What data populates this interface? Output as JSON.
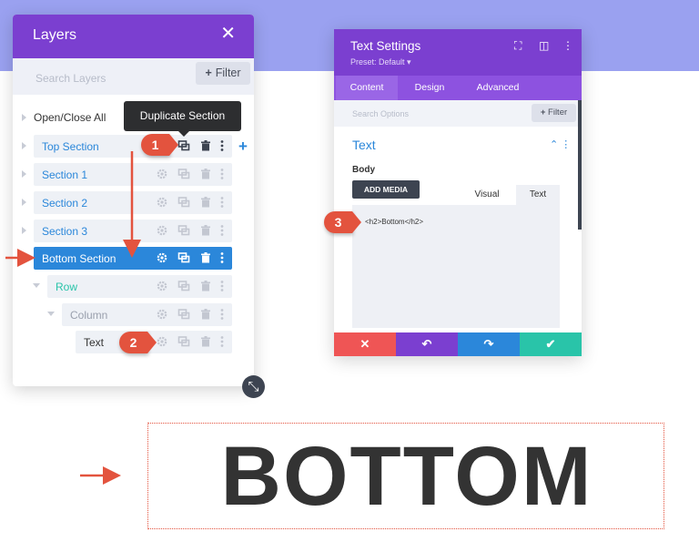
{
  "layers_panel": {
    "title": "Layers",
    "close_icon": "close-icon",
    "search_placeholder": "Search Layers",
    "filter_label": "Filter",
    "open_close_all": "Open/Close All",
    "tooltip": "Duplicate Section",
    "items": [
      {
        "label": "Top Section",
        "type": "section"
      },
      {
        "label": "Section 1",
        "type": "section"
      },
      {
        "label": "Section 2",
        "type": "section"
      },
      {
        "label": "Section 3",
        "type": "section"
      },
      {
        "label": "Bottom Section",
        "type": "section",
        "selected": true
      },
      {
        "label": "Row",
        "type": "row"
      },
      {
        "label": "Column",
        "type": "column"
      },
      {
        "label": "Text",
        "type": "module"
      }
    ],
    "icons": [
      "gear-icon",
      "duplicate-icon",
      "trash-icon",
      "more-icon"
    ]
  },
  "badges": [
    "1",
    "2",
    "3"
  ],
  "text_settings": {
    "title": "Text Settings",
    "preset": "Preset: Default ▾",
    "tabs": [
      "Content",
      "Design",
      "Advanced"
    ],
    "active_tab": "Content",
    "search_placeholder": "Search Options",
    "filter_label": "Filter",
    "section_title": "Text",
    "body_label": "Body",
    "add_media": "ADD MEDIA",
    "editor_modes": [
      "Visual",
      "Text"
    ],
    "editor_content": "<h2>Bottom</h2>",
    "footer_buttons": [
      {
        "name": "discard",
        "icon": "✕",
        "color": "#ef5555"
      },
      {
        "name": "undo",
        "icon": "↶",
        "color": "#7b3fd0"
      },
      {
        "name": "redo",
        "icon": "↷",
        "color": "#2b87da"
      },
      {
        "name": "save",
        "icon": "✔",
        "color": "#29c4a9"
      }
    ]
  },
  "heading": "BOTTOM",
  "colors": {
    "purple": "#7b3fd0",
    "blue": "#2b87da",
    "teal": "#29c4a9",
    "red_annotation": "#e3533e",
    "band": "#9aa1f0"
  }
}
